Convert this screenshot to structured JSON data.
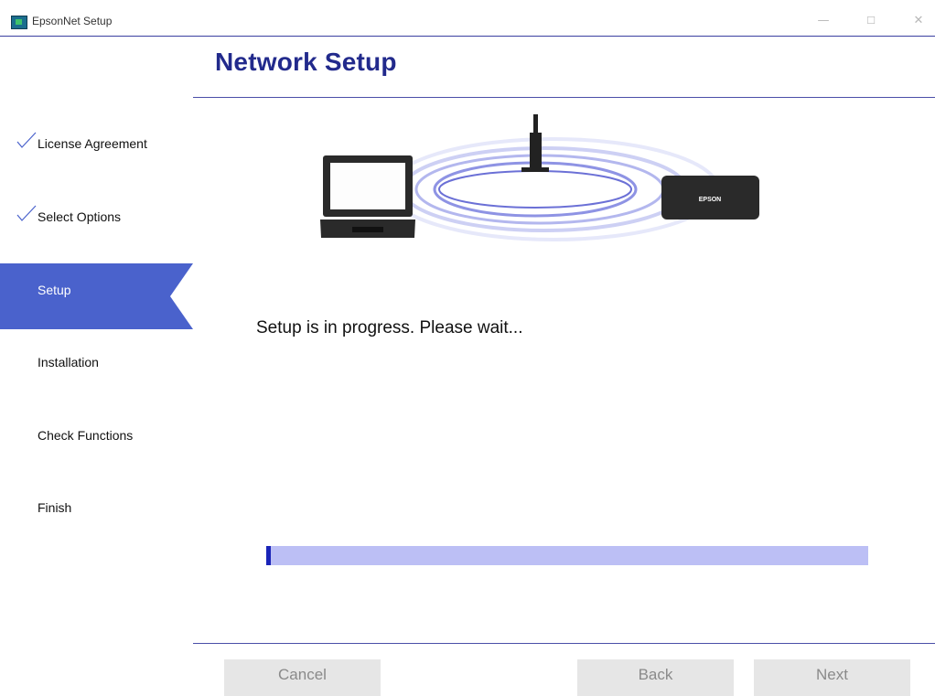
{
  "window": {
    "title": "EpsonNet Setup",
    "controls": {
      "minimize": "—",
      "maximize": "☐",
      "close": "✕"
    }
  },
  "header": {
    "title": "Network Setup"
  },
  "sidebar": {
    "steps": [
      {
        "label": "License Agreement",
        "state": "done"
      },
      {
        "label": "Select Options",
        "state": "done"
      },
      {
        "label": "Setup",
        "state": "active"
      },
      {
        "label": "Installation",
        "state": "pending"
      },
      {
        "label": "Check Functions",
        "state": "pending"
      },
      {
        "label": "Finish",
        "state": "pending"
      }
    ]
  },
  "illustration": {
    "printer_brand": "EPSON"
  },
  "main": {
    "status": "Setup is in progress. Please wait...",
    "progress_fraction": 0.008
  },
  "footer": {
    "cancel_label": "Cancel",
    "back_label": "Back",
    "next_label": "Next"
  },
  "colors": {
    "accent": "#4a62cc",
    "title": "#222a8c",
    "progress_track": "#bcbff5",
    "progress_fill": "#1a24b8"
  }
}
